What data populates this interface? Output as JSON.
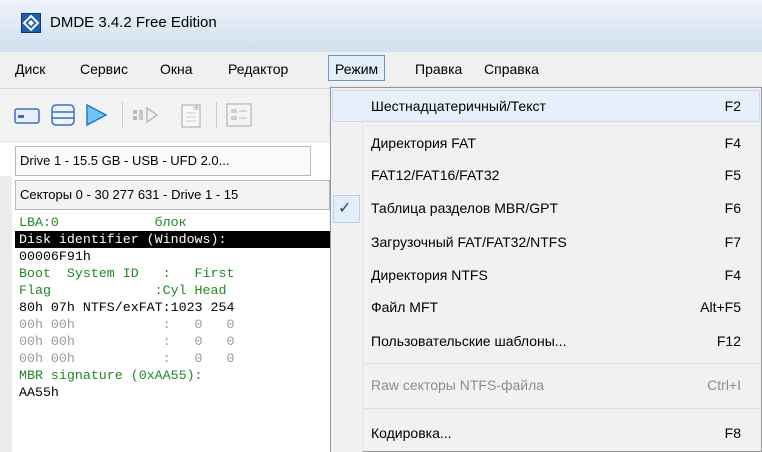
{
  "window": {
    "title": "DMDE 3.4.2 Free Edition"
  },
  "menubar": {
    "items": [
      "Диск",
      "Сервис",
      "Окна",
      "Редактор",
      "Режим",
      "Правка",
      "Справка"
    ]
  },
  "drive_tab": {
    "label": "Drive 1 - 15.5 GB - USB - UFD 2.0..."
  },
  "sector_tab": {
    "label": "Секторы 0 - 30 277 631 - Drive 1 - 15"
  },
  "panel_lines": [
    "LBA:0            блок",
    "Disk identifier (Windows):",
    "00006F91h",
    "Boot  System ID   :   First",
    "Flag             :Cyl Head",
    "80h 07h NTFS/exFAT:1023 254",
    "00h 00h           :   0   0",
    "00h 00h           :   0   0",
    "00h 00h           :   0   0",
    "MBR signature (0xAA55):",
    "AA55h"
  ],
  "dropdown": {
    "items": [
      {
        "label": "Шестнадцатеричный/Текст",
        "shortcut": "F2"
      },
      {
        "label": "Директория FAT",
        "shortcut": "F4"
      },
      {
        "label": "FAT12/FAT16/FAT32",
        "shortcut": "F5"
      },
      {
        "label": "Таблица разделов MBR/GPT",
        "shortcut": "F6",
        "checked": true
      },
      {
        "label": "Загрузочный FAT/FAT32/NTFS",
        "shortcut": "F7"
      },
      {
        "label": "Директория NTFS",
        "shortcut": "F4"
      },
      {
        "label": "Файл MFT",
        "shortcut": "Alt+F5"
      },
      {
        "label": "Пользовательские шаблоны...",
        "shortcut": "F12"
      },
      {
        "label": "Raw секторы NTFS-файла",
        "shortcut": "Ctrl+I",
        "disabled": true
      },
      {
        "label": "Кодировка...",
        "shortcut": "F8"
      }
    ],
    "check_mark": "✓"
  },
  "colors": {
    "accent": "#6d95c9",
    "text_green": "#1f8a24",
    "selection_bg": "#000000"
  }
}
